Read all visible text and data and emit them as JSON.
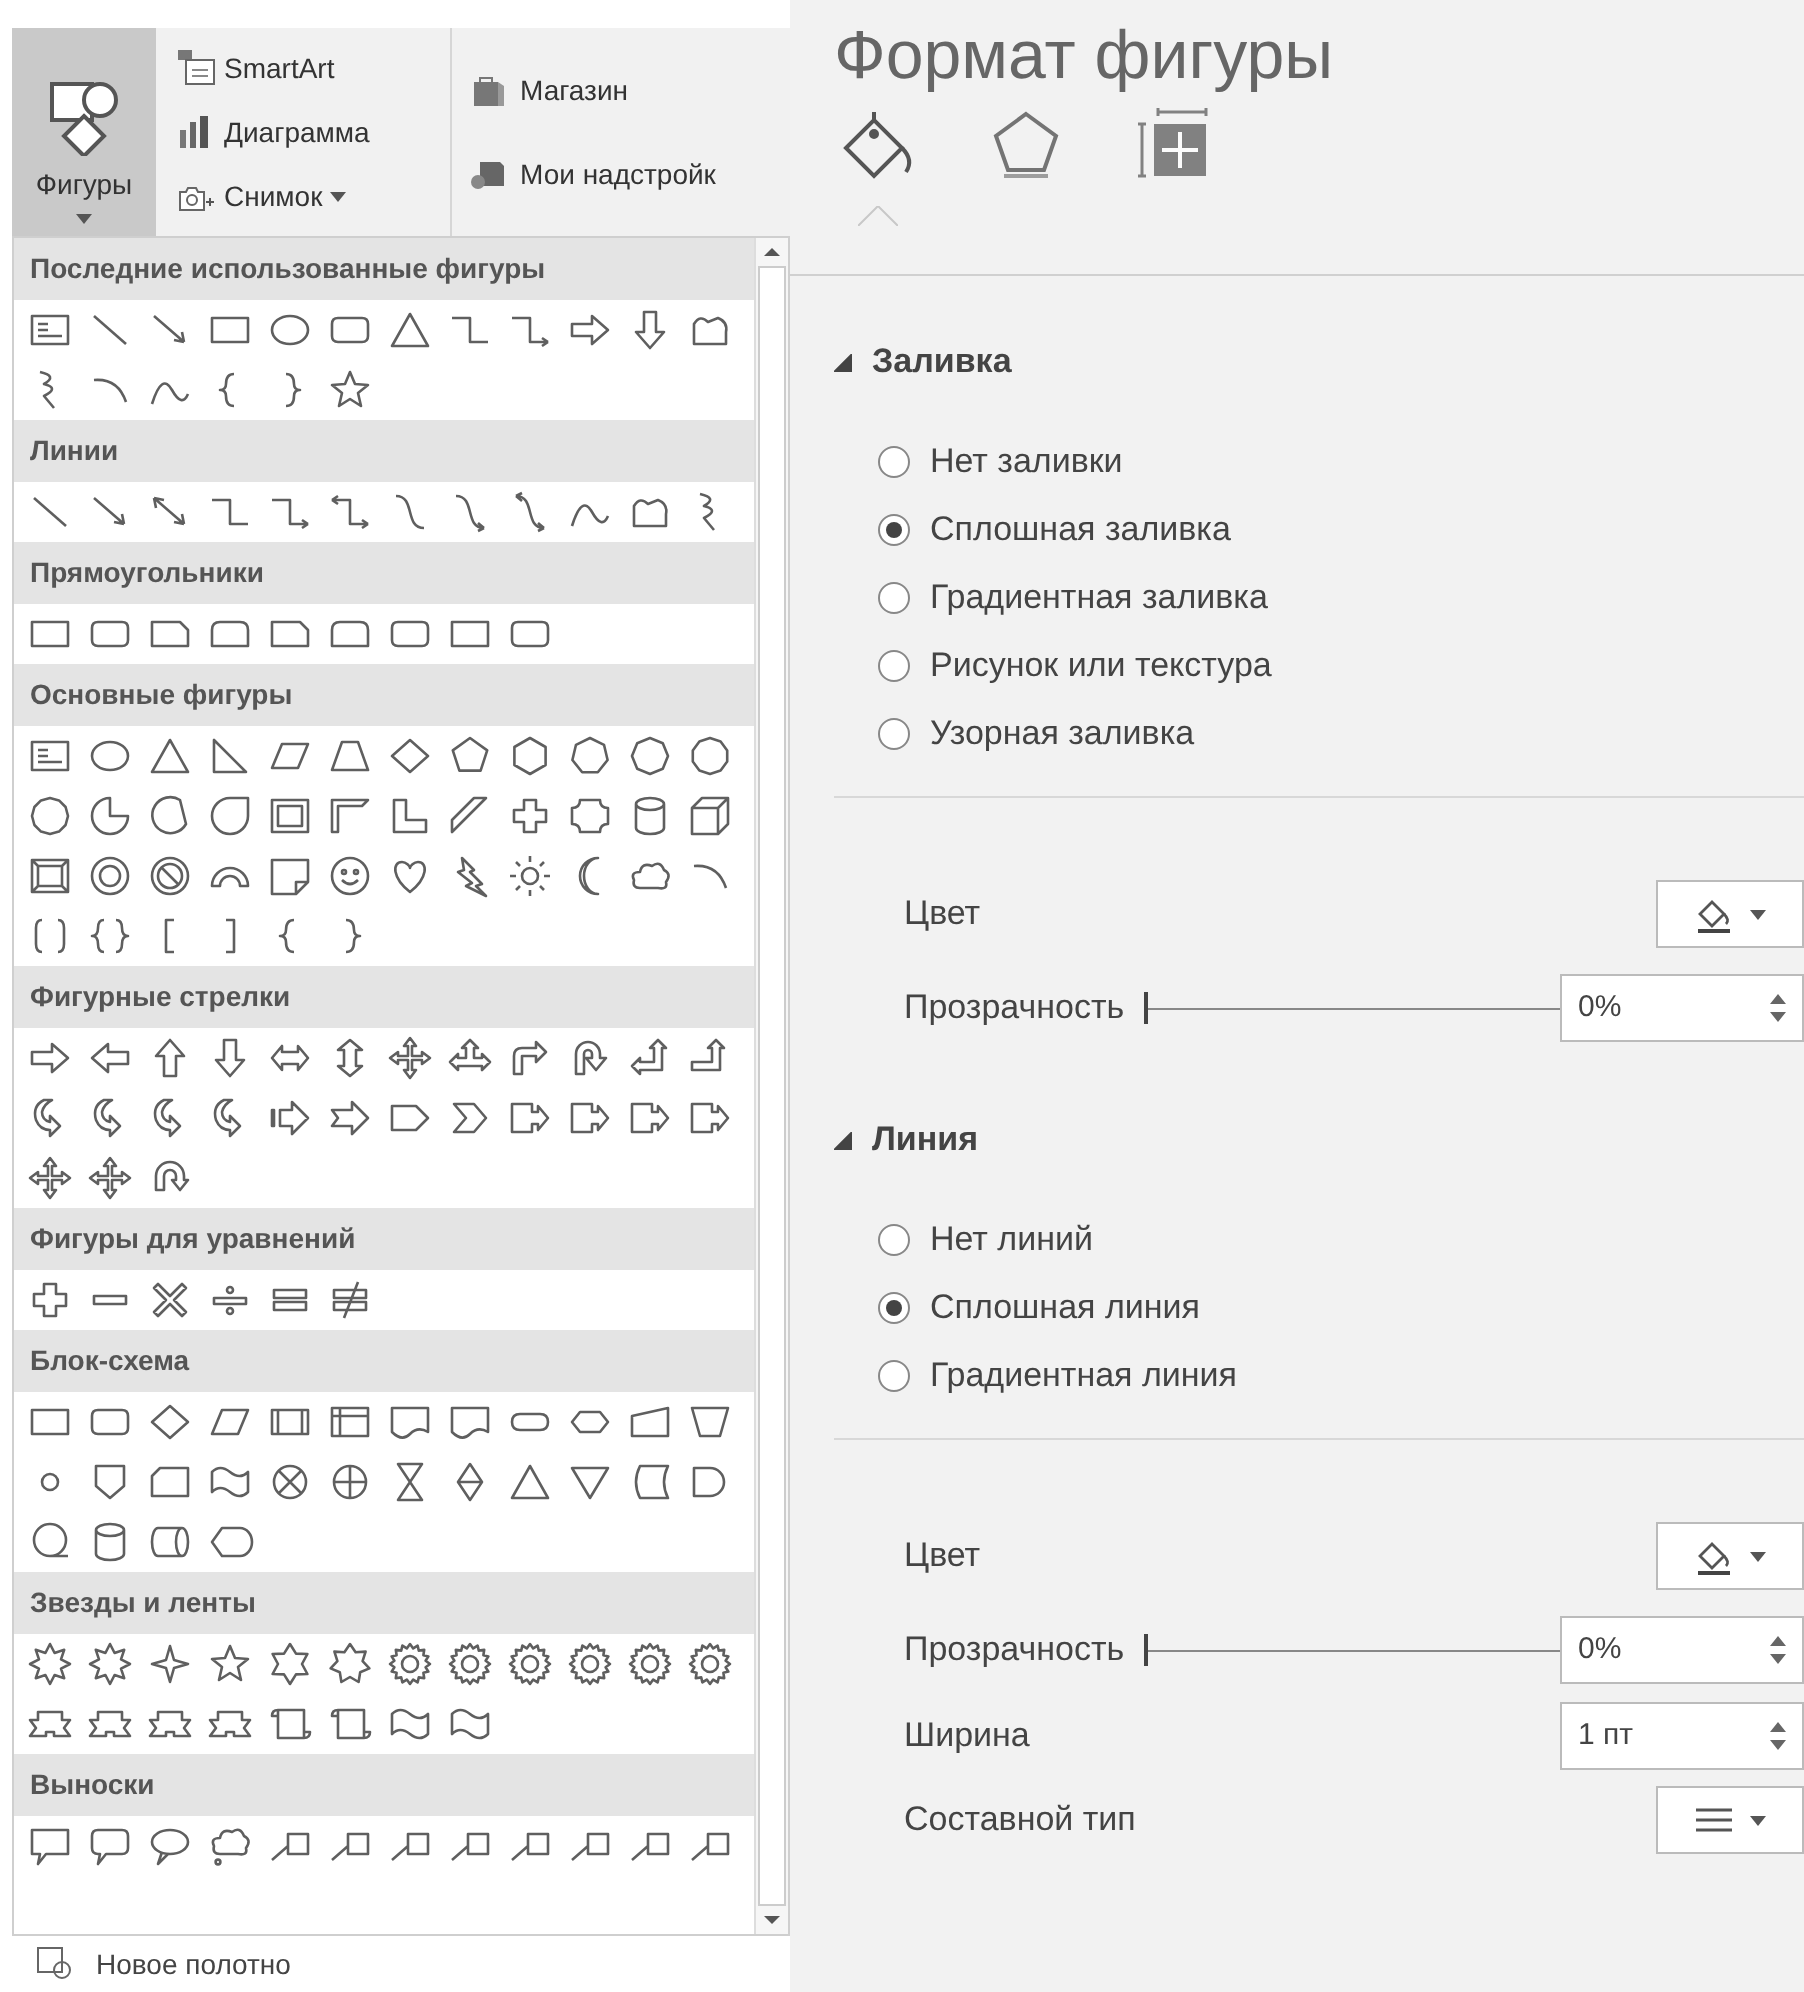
{
  "ribbon": {
    "shapes_button": {
      "label": "Фигуры",
      "selected": true
    },
    "insert_items": [
      {
        "label": "SmartArt",
        "kind": "smartart",
        "dropdown": false
      },
      {
        "label": "Диаграмма",
        "kind": "chart",
        "dropdown": false
      },
      {
        "label": "Снимок",
        "kind": "screenshot",
        "dropdown": true
      }
    ],
    "addin_items": [
      {
        "label": "Магазин",
        "kind": "store"
      },
      {
        "label": "Мои надстройк",
        "kind": "addins"
      }
    ]
  },
  "gallery": {
    "sections": [
      {
        "title": "Последние использованные фигуры"
      },
      {
        "title": "Линии"
      },
      {
        "title": "Прямоугольники"
      },
      {
        "title": "Основные фигуры"
      },
      {
        "title": "Фигурные стрелки"
      },
      {
        "title": "Фигуры для уравнений"
      },
      {
        "title": "Блок-схема"
      },
      {
        "title": "Звезды и ленты"
      },
      {
        "title": "Выноски"
      }
    ],
    "footer": "Новое полотно"
  },
  "format_pane": {
    "title": "Формат фигуры",
    "tabs": [
      {
        "kind": "fill",
        "selected": true
      },
      {
        "kind": "effects",
        "selected": false
      },
      {
        "kind": "size",
        "selected": false
      }
    ],
    "sections": [
      {
        "title": "Заливка",
        "expanded": true,
        "options": [
          {
            "label": "Нет заливки",
            "selected": false
          },
          {
            "label": "Сплошная заливка",
            "selected": true
          },
          {
            "label": "Градиентная заливка",
            "selected": false
          },
          {
            "label": "Рисунок или текстура",
            "selected": false
          },
          {
            "label": "Узорная заливка",
            "selected": false
          }
        ],
        "properties": [
          {
            "kind": "color",
            "label": "Цвет"
          },
          {
            "kind": "slider",
            "label": "Прозрачность",
            "level": 0,
            "value": "0%"
          }
        ]
      },
      {
        "title": "Линия",
        "expanded": true,
        "options": [
          {
            "label": "Нет линий",
            "selected": false
          },
          {
            "label": "Сплошная линия",
            "selected": true
          },
          {
            "label": "Градиентная линия",
            "selected": false
          }
        ],
        "properties": [
          {
            "kind": "color",
            "label": "Цвет"
          },
          {
            "kind": "slider",
            "label": "Прозрачность",
            "level": 0,
            "value": "0%"
          },
          {
            "kind": "spin",
            "label": "Ширина",
            "value": "1 пт"
          },
          {
            "kind": "line_style",
            "label": "Составной тип"
          }
        ]
      }
    ]
  }
}
